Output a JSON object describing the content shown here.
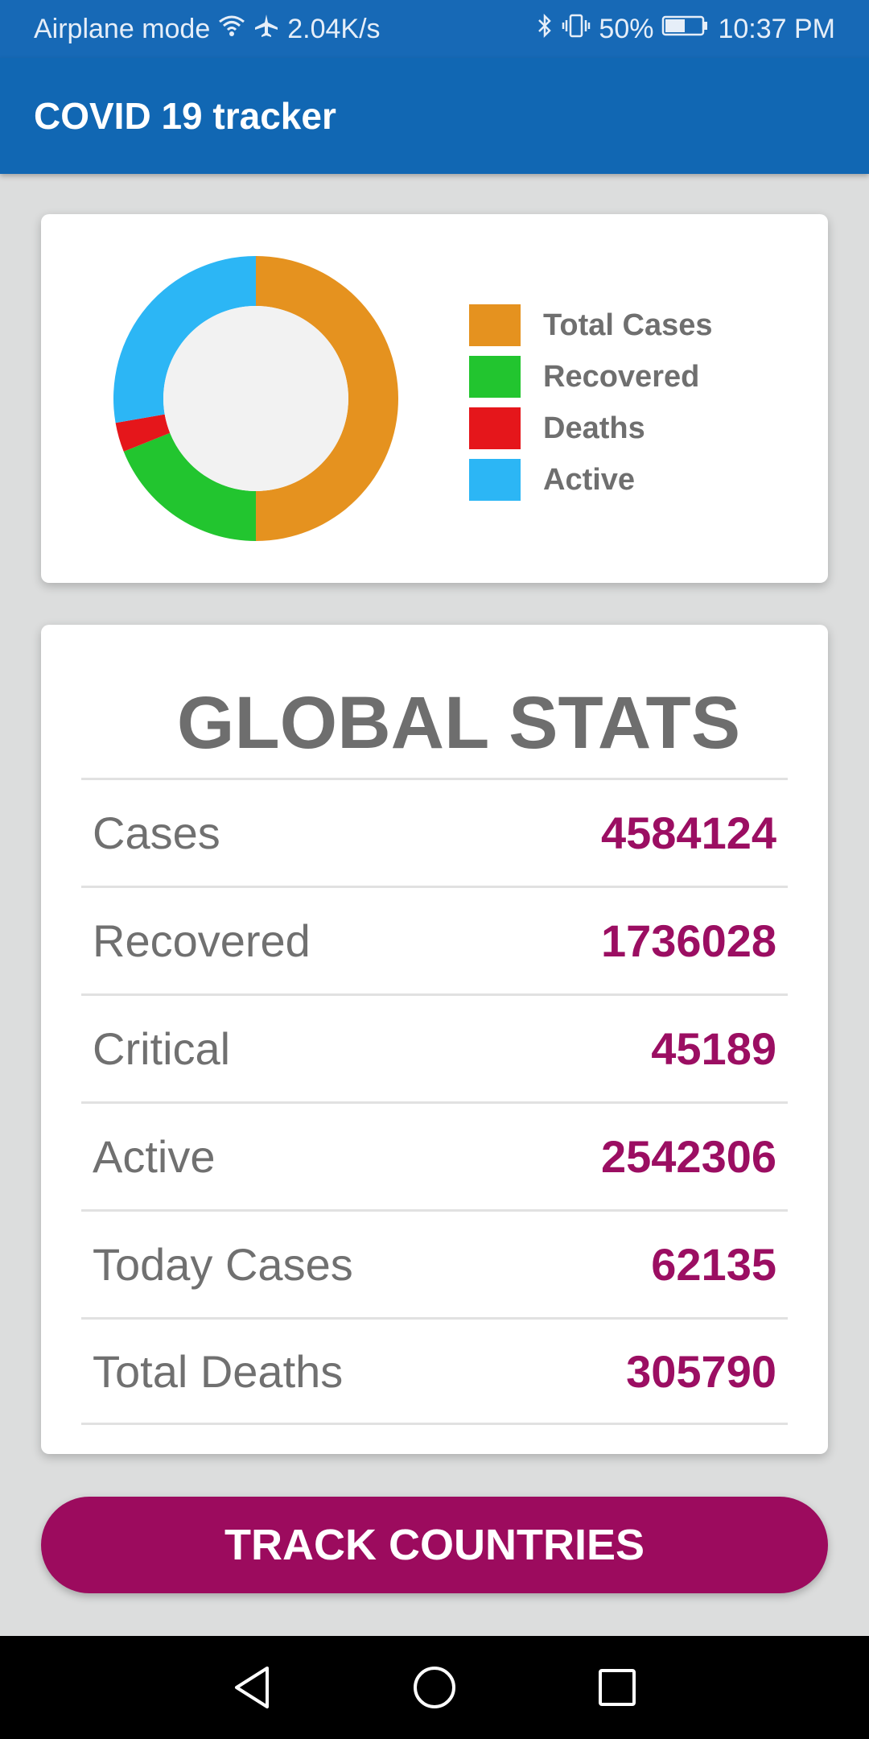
{
  "status_bar": {
    "left_text": "Airplane mode",
    "speed": "2.04K/s",
    "battery": "50%",
    "time": "10:37 PM",
    "icons": [
      "wifi-icon",
      "airplane-icon",
      "bluetooth-icon",
      "vibrate-icon",
      "battery-icon"
    ]
  },
  "app_bar": {
    "title": "COVID 19 tracker"
  },
  "chart_data": {
    "type": "pie",
    "style": "donut",
    "labels": [
      "Total Cases",
      "Recovered",
      "Deaths",
      "Active"
    ],
    "values": [
      4584124,
      1736028,
      305790,
      2542306
    ],
    "colors": [
      "#e5921f",
      "#22c52f",
      "#e5161b",
      "#2cb6f5"
    ],
    "legend_position": "right"
  },
  "legend": {
    "items": [
      {
        "label": "Total Cases",
        "color": "#e5921f"
      },
      {
        "label": "Recovered",
        "color": "#22c52f"
      },
      {
        "label": "Deaths",
        "color": "#e5161b"
      },
      {
        "label": "Active",
        "color": "#2cb6f5"
      }
    ]
  },
  "stats": {
    "title": "GLOBAL STATS",
    "rows": [
      {
        "label": "Cases",
        "value": "4584124"
      },
      {
        "label": "Recovered",
        "value": "1736028"
      },
      {
        "label": "Critical",
        "value": "45189"
      },
      {
        "label": "Active",
        "value": "2542306"
      },
      {
        "label": "Today Cases",
        "value": "62135"
      },
      {
        "label": "Total Deaths",
        "value": "305790"
      }
    ]
  },
  "button": {
    "label": "TRACK COUNTRIES",
    "color": "#9c0b5e"
  },
  "nav_bar": {
    "icons": [
      "back-icon",
      "home-icon",
      "recents-icon"
    ]
  }
}
